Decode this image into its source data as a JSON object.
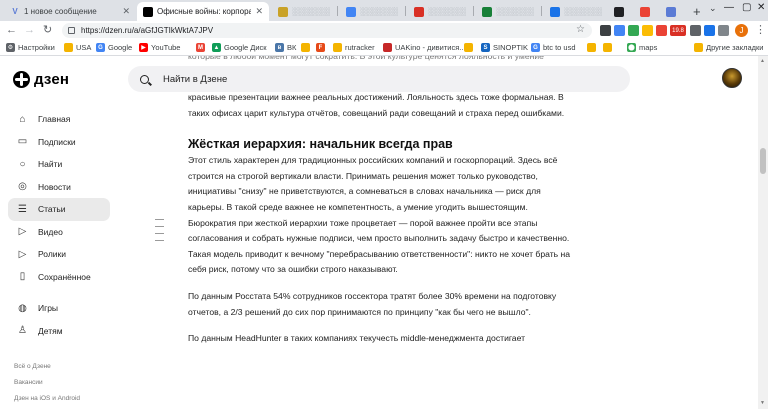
{
  "browser": {
    "tabs": [
      {
        "title": "1 новое сообщение",
        "fav": "V",
        "fav_color": "#5b7bd5",
        "active": false
      },
      {
        "title": "Офисные войны: корпоративн",
        "fav": "Д",
        "fav_color": "#000000",
        "active": true
      },
      {
        "title": "",
        "fav": "",
        "fav_color": "#c9a227",
        "active": false
      },
      {
        "title": "",
        "fav": "",
        "fav_color": "#4285f4",
        "active": false
      },
      {
        "title": "",
        "fav": "",
        "fav_color": "#d93025",
        "active": false
      },
      {
        "title": "",
        "fav": "",
        "fav_color": "#188038",
        "active": false
      },
      {
        "title": "",
        "fav": "",
        "fav_color": "#1a73e8",
        "active": false
      },
      {
        "title": "",
        "fav": "",
        "fav_color": "#202124",
        "active": false
      },
      {
        "title": "",
        "fav": "",
        "fav_color": "#ea4335",
        "active": false
      },
      {
        "title": "",
        "fav": "",
        "fav_color": "#5b7bd5",
        "active": false
      }
    ],
    "url": "https://dzen.ru/a/aGfJGTIkWktA7JPV",
    "bookmarks": [
      {
        "label": "Настройки",
        "icon": "gear-icon",
        "color": "#5f6368"
      },
      {
        "label": "USA",
        "icon": "folder-icon",
        "color": "#f4b400"
      },
      {
        "label": "Google",
        "icon": "google-icon",
        "color": "#4285f4"
      },
      {
        "label": "YouTube",
        "icon": "youtube-icon",
        "color": "#ff0000"
      },
      {
        "label": "",
        "icon": "gmail-icon",
        "color": "#ea4335"
      },
      {
        "label": "Google Диск",
        "icon": "drive-icon",
        "color": "#0f9d58"
      },
      {
        "label": "ВК",
        "icon": "vk-icon",
        "color": "#4a76a8"
      },
      {
        "label": "",
        "icon": "folder-icon",
        "color": "#f4b400"
      },
      {
        "label": "",
        "icon": "bookmark-icon",
        "color": "#e64a19"
      },
      {
        "label": "rutracker",
        "icon": "folder-icon",
        "color": "#f4b400"
      },
      {
        "label": "UAKino - дивитися...",
        "icon": "uakino-icon",
        "color": "#c62828"
      },
      {
        "label": "",
        "icon": "folder-icon",
        "color": "#f4b400"
      },
      {
        "label": "SINOPTIK",
        "icon": "sinoptik-icon",
        "color": "#1565c0"
      },
      {
        "label": "btc to usd",
        "icon": "google-icon",
        "color": "#4285f4"
      },
      {
        "label": "",
        "icon": "folder-icon",
        "color": "#f4b400"
      },
      {
        "label": "",
        "icon": "folder-icon",
        "color": "#f4b400"
      },
      {
        "label": "maps",
        "icon": "maps-icon",
        "color": "#34a853"
      },
      {
        "label": "Другие закладки",
        "icon": "folder-icon",
        "color": "#f4b400"
      }
    ],
    "extension_badge": "19.8"
  },
  "site": {
    "logo": "дзен",
    "search_placeholder": "Найти в Дзене"
  },
  "sidebar": {
    "items": [
      {
        "label": "Главная",
        "icon": "home-icon",
        "active": false
      },
      {
        "label": "Подписки",
        "icon": "subscriptions-icon",
        "active": false
      },
      {
        "label": "Найти",
        "icon": "search-icon",
        "active": false
      },
      {
        "label": "Новости",
        "icon": "news-icon",
        "active": false
      },
      {
        "label": "Статьи",
        "icon": "articles-icon",
        "active": true
      },
      {
        "label": "Видео",
        "icon": "video-icon",
        "active": false
      },
      {
        "label": "Ролики",
        "icon": "shorts-icon",
        "active": false
      },
      {
        "label": "Сохранённое",
        "icon": "bookmark-icon",
        "active": false
      }
    ],
    "items2": [
      {
        "label": "Игры",
        "icon": "gamepad-icon",
        "active": false
      },
      {
        "label": "Детям",
        "icon": "kids-icon",
        "active": false
      }
    ],
    "footer": [
      "Всё о Дзене",
      "Вакансии",
      "Дзен на iOS и Android"
    ]
  },
  "article": {
    "top_partial": "которые в любой момент могут сократить. В этой культуре ценятся лояльность и умение",
    "p1": "красивые презентации важнее реальных достижений. Лояльность здесь тоже формальная. В таких офисах царит культура отчётов, совещаний ради совещаний и страха перед ошибками.",
    "heading": "Жёсткая иерархия: начальник всегда прав",
    "p2": "Этот стиль характерен для традиционных российских компаний и госкорпораций. Здесь всё строится на строгой вертикали власти. Принимать решения может только руководство, инициативы \"снизу\" не приветствуются, а сомневаться в словах начальника — риск для карьеры. В такой среде важнее не компетентность, а умение угодить вышестоящим. Бюрократия при жесткой иерархии тоже процветает — порой важнее пройти все этапы согласования и собрать нужные подписи, чем просто выполнить задачу быстро и качественно. Такая модель приводит к вечному \"перебрасыванию ответственности\": никто не хочет брать на себя риск, потому что за ошибки строго наказывают.",
    "p3": "По данным Росстата 54% сотрудников госсектора тратят более 30% времени на подготовку отчетов, а 2/3 решений до сих пор принимаются по принципу \"как бы чего не вышло\".",
    "bottom_partial": "По данным HeadHunter в таких компаниях текучесть middle-менеджмента достигает"
  }
}
